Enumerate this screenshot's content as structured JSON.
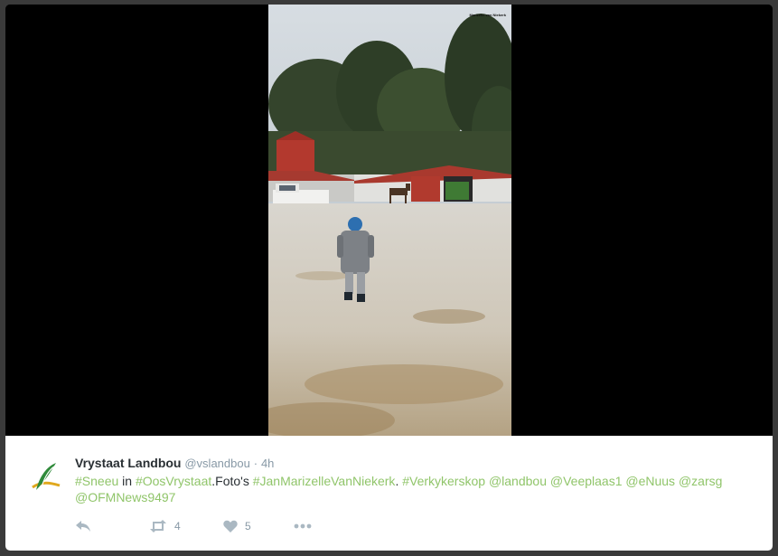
{
  "photo": {
    "credit": "Marizelle van Niekerk"
  },
  "tweet": {
    "author_name": "Vrystaat Landbou",
    "author_handle": "@vslandbou",
    "separator": "·",
    "time": "4h",
    "text_segments": [
      {
        "text": "#Sneeu",
        "link": true
      },
      {
        "text": " in ",
        "link": false
      },
      {
        "text": "#OosVrystaat",
        "link": true
      },
      {
        "text": ".Foto's ",
        "link": false
      },
      {
        "text": "#JanMarizelleVanNiekerk",
        "link": true
      },
      {
        "text": ". ",
        "link": false
      },
      {
        "text": "#Verkykerskop",
        "link": true
      },
      {
        "text": " ",
        "link": false
      },
      {
        "text": "@landbou",
        "link": true
      },
      {
        "text": " ",
        "link": false
      },
      {
        "text": "@Veeplaas1",
        "link": true
      },
      {
        "text": " ",
        "link": false
      },
      {
        "text": "@eNuus",
        "link": true
      },
      {
        "text": " ",
        "link": false
      },
      {
        "text": "@zarsg",
        "link": true
      },
      {
        "text": " ",
        "link": false
      },
      {
        "text": "@OFMNews9497",
        "link": true
      }
    ],
    "actions": {
      "reply_icon": "reply-icon",
      "retweet_icon": "retweet-icon",
      "retweet_count": "4",
      "like_icon": "heart-icon",
      "like_count": "5",
      "more_icon": "more-icon"
    }
  },
  "colors": {
    "link": "#90c56a",
    "name": "#292f33",
    "meta": "#8899a6",
    "icon": "#aab8c2"
  }
}
